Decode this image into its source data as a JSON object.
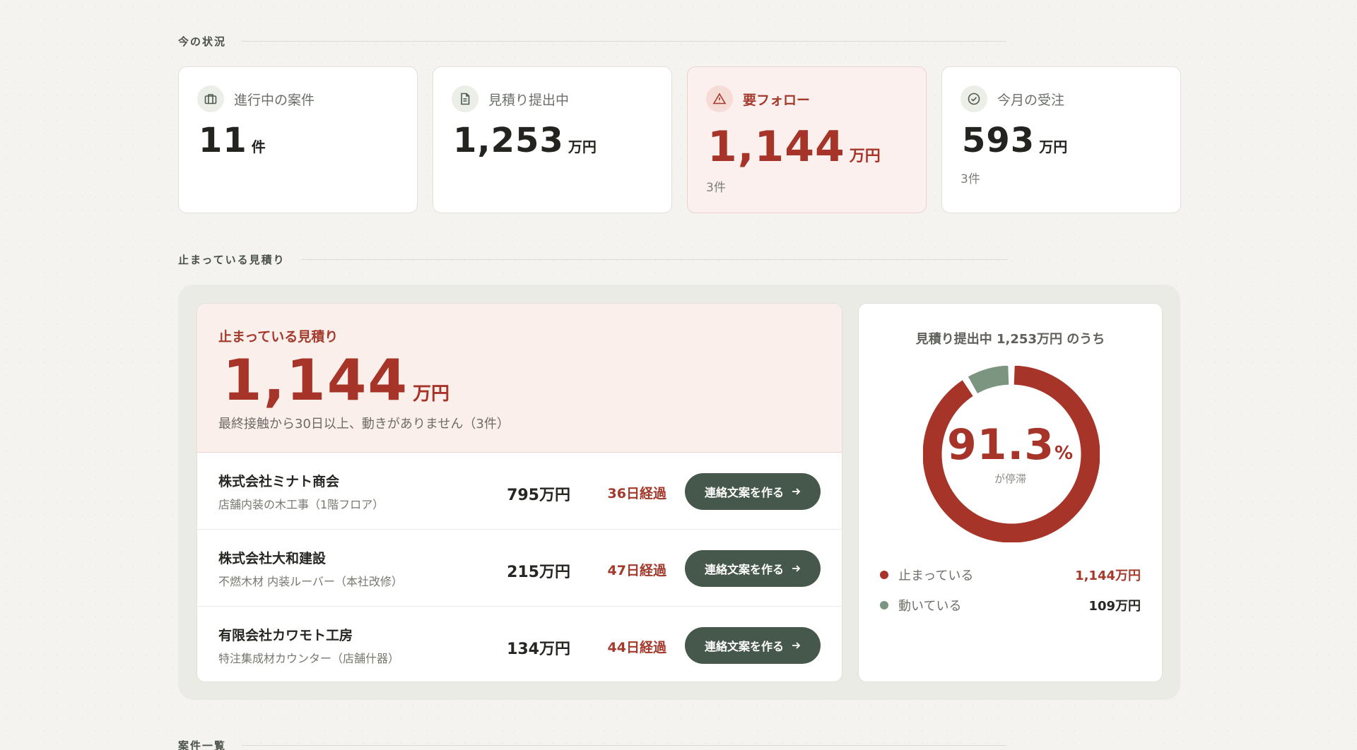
{
  "sections": {
    "status": "今の状況",
    "stalled": "止まっている見積り",
    "projects": "案件一覧"
  },
  "stats": [
    {
      "label": "進行中の案件",
      "value": "11",
      "unit": "件",
      "sub": "",
      "icon": "briefcase-icon"
    },
    {
      "label": "見積り提出中",
      "value": "1,253",
      "unit": "万円",
      "sub": "",
      "icon": "document-icon"
    },
    {
      "label": "要フォロー",
      "value": "1,144",
      "unit": "万円",
      "sub": "3件",
      "icon": "warning-icon"
    },
    {
      "label": "今月の受注",
      "value": "593",
      "unit": "万円",
      "sub": "3件",
      "icon": "check-circle-icon"
    }
  ],
  "stalled": {
    "title": "止まっている見積り",
    "value": "1,144",
    "unit": "万円",
    "description": "最終接触から30日以上、動きがありません（3件）",
    "rows": [
      {
        "company": "株式会社ミナト商会",
        "project": "店舗内装の木工事（1階フロア）",
        "amount": "795万円",
        "days": "36日経過",
        "action": "連絡文案を作る"
      },
      {
        "company": "株式会社大和建設",
        "project": "不燃木材 内装ルーバー（本社改修）",
        "amount": "215万円",
        "days": "47日経過",
        "action": "連絡文案を作る"
      },
      {
        "company": "有限会社カワモト工房",
        "project": "特注集成材カウンター（店舗什器）",
        "amount": "134万円",
        "days": "44日経過",
        "action": "連絡文案を作る"
      }
    ]
  },
  "donut": {
    "title": "見積り提出中 1,253万円 のうち",
    "percent": "91.3",
    "percent_unit": "%",
    "caption": "が停滞",
    "legend": [
      {
        "label": "止まっている",
        "value": "1,144万円"
      },
      {
        "label": "動いている",
        "value": "109万円"
      }
    ]
  },
  "colors": {
    "accent_red": "#a73428",
    "muted_green": "#7b9581",
    "button_green": "#46574b"
  },
  "chart_data": {
    "type": "pie",
    "title": "見積り提出中 1,253万円 のうち",
    "categories": [
      "止まっている",
      "動いている"
    ],
    "values": [
      1144,
      109
    ],
    "colors": [
      "#a73428",
      "#7b9581"
    ]
  }
}
